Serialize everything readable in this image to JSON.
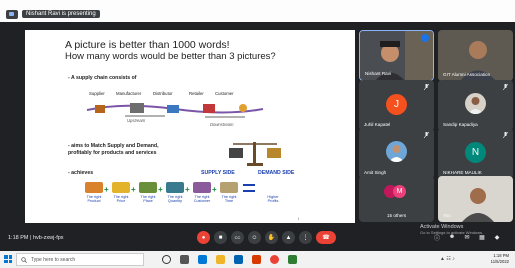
{
  "top": {
    "presenter_text": "Nishant Ravi is presenting"
  },
  "slide": {
    "title": "A picture is better than 1000 words!",
    "subtitle": "How many words would be better than 3 pictures?",
    "bullet_supply": "- A supply chain consists of",
    "chain_labels": [
      "Supplier",
      "Manufacturer",
      "Distributor",
      "Retailer",
      "Customer"
    ],
    "upstream": "Upstream",
    "downstream": "Downstream",
    "bullet_aims_1": "- aims to Match Supply and Demand,",
    "bullet_aims_2": "profitably for products and services",
    "supply_side": "SUPPLY SIDE",
    "demand_side": "DEMAND SIDE",
    "bullet_achieves": "- achieves",
    "rights": [
      {
        "line1": "The right",
        "line2": "Product",
        "color": "#d9822b"
      },
      {
        "line1": "The right",
        "line2": "Price",
        "color": "#e3b32b"
      },
      {
        "line1": "The right",
        "line2": "Place",
        "color": "#6a8f3a"
      },
      {
        "line1": "The right",
        "line2": "Quantity",
        "color": "#3a7a8f"
      },
      {
        "line1": "The right",
        "line2": "Customer",
        "color": "#8a5a9a"
      },
      {
        "line1": "The right",
        "line2": "Time",
        "color": "#b5a070"
      }
    ],
    "profits_line1": "Higher",
    "profits_line2": "Profits",
    "cursor_mark": "I"
  },
  "participants": [
    {
      "name": "Nishant Ravi",
      "kind": "photo",
      "active": true
    },
    {
      "name": "GIT Alumni Association",
      "kind": "photo"
    },
    {
      "name": "Juhil Kapatel",
      "kind": "initial",
      "initial": "J",
      "color": "#f4511e"
    },
    {
      "name": "Sandip Kapadiya",
      "kind": "photo"
    },
    {
      "name": "Amit Singh",
      "kind": "photo"
    },
    {
      "name": "NIKHARE MAULIK",
      "kind": "initial",
      "initial": "N",
      "color": "#00897b"
    },
    {
      "name": "15 others",
      "kind": "group"
    },
    {
      "name": "You",
      "kind": "photo"
    }
  ],
  "controls": {
    "time": "1:18 PM",
    "separator": "|",
    "code": "hvb-zxwj-fpx"
  },
  "watermark": {
    "line1": "Activate Windows",
    "line2": "Go to Settings to activate Windows."
  },
  "taskbar": {
    "search_placeholder": "Type here to search",
    "time": "1:18 PM",
    "date": "11/5/2022"
  },
  "colors": {
    "meet_dark": "#202124",
    "tile": "#3c4043",
    "end_call": "#ea4335",
    "accent_blue": "#1a3fb0"
  }
}
